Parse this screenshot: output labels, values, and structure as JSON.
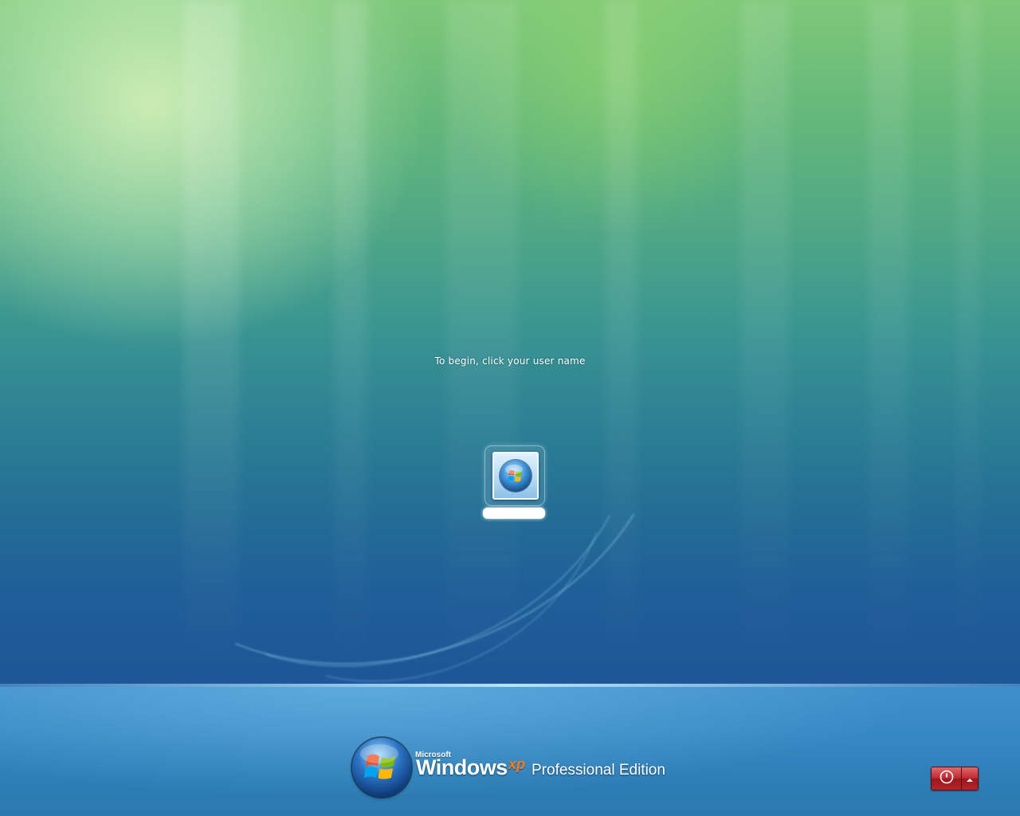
{
  "logon": {
    "instruction": "To begin, click your user name",
    "user": {
      "name": "",
      "picture_icon": "windows-orb-icon"
    }
  },
  "branding": {
    "microsoft": "Microsoft",
    "windows": "Windows",
    "xp": "xp",
    "edition": "Professional Edition",
    "logo_icon": "windows-flag-orb-icon"
  },
  "shutdown": {
    "power_icon": "power-icon",
    "options_icon": "chevron-up-icon"
  },
  "colors": {
    "background_top": "#7ec879",
    "background_bottom": "#1e5797",
    "floor": "#3789c4",
    "shutdown_red": "#c12a2f",
    "xp_orange": "#ff7a1a"
  }
}
